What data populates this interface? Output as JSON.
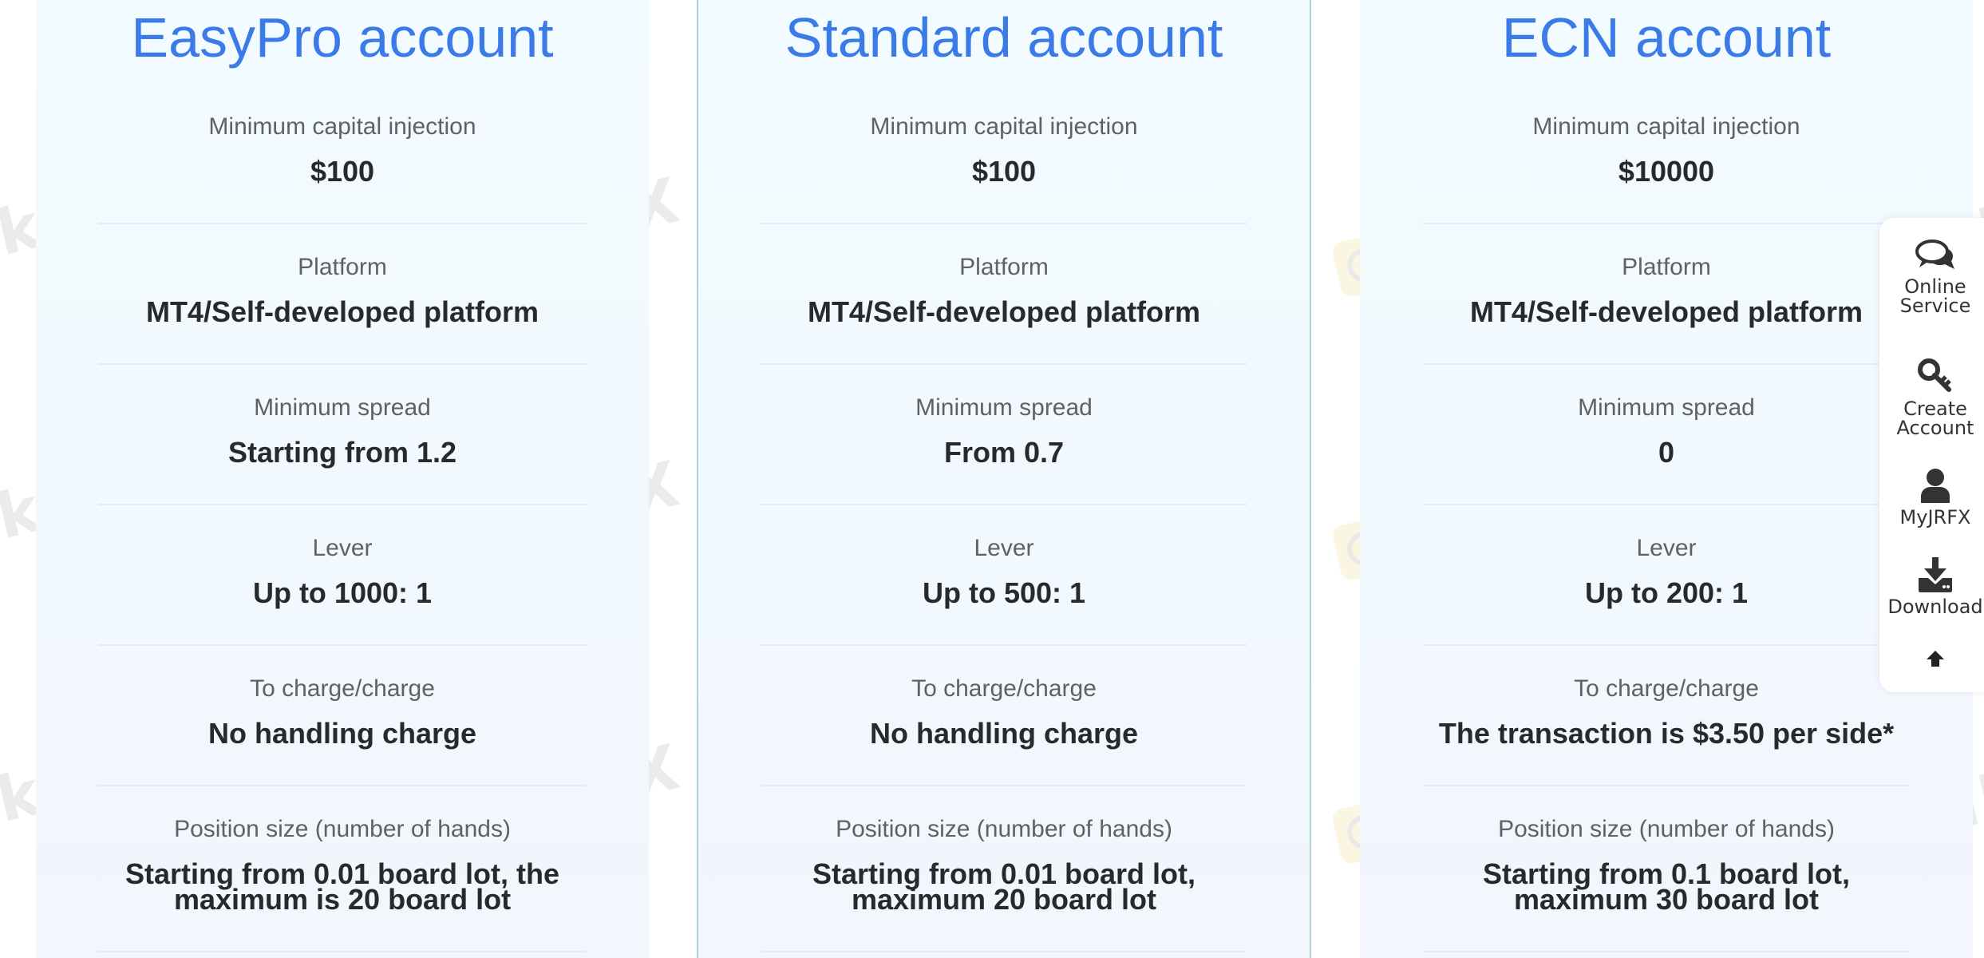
{
  "accounts": [
    {
      "title": "EasyPro account",
      "rows": [
        {
          "label": "Minimum capital injection",
          "value": "$100"
        },
        {
          "label": "Platform",
          "value": "MT4/Self-developed platform"
        },
        {
          "label": "Minimum spread",
          "value": "Starting from 1.2"
        },
        {
          "label": "Lever",
          "value": "Up to 1000: 1"
        },
        {
          "label": "To charge/charge",
          "value": "No handling charge"
        },
        {
          "label": "Position size (number of hands)",
          "value": "Starting from 0.01 board lot, the maximum is 20 board lot"
        }
      ]
    },
    {
      "title": "Standard account",
      "rows": [
        {
          "label": "Minimum capital injection",
          "value": "$100"
        },
        {
          "label": "Platform",
          "value": "MT4/Self-developed platform"
        },
        {
          "label": "Minimum spread",
          "value": "From 0.7"
        },
        {
          "label": "Lever",
          "value": "Up to 500: 1"
        },
        {
          "label": "To charge/charge",
          "value": "No handling charge"
        },
        {
          "label": "Position size (number of hands)",
          "value": "Starting from 0.01 board lot, maximum 20 board lot"
        }
      ]
    },
    {
      "title": "ECN account",
      "rows": [
        {
          "label": "Minimum capital injection",
          "value": "$10000"
        },
        {
          "label": "Platform",
          "value": "MT4/Self-developed platform"
        },
        {
          "label": "Minimum spread",
          "value": "0"
        },
        {
          "label": "Lever",
          "value": "Up to 200: 1"
        },
        {
          "label": "To charge/charge",
          "value": "The transaction is $3.50 per side*"
        },
        {
          "label": "Position size (number of hands)",
          "value": "Starting from 0.1 board lot, maximum 30 board lot"
        }
      ]
    }
  ],
  "sidebar": {
    "items": [
      {
        "label_line1": "Online",
        "label_line2": "Service",
        "icon": "chat-bubbles-icon"
      },
      {
        "label_line1": "Create",
        "label_line2": "Account",
        "icon": "key-icon"
      },
      {
        "label_line1": "MyJRFX",
        "icon": "user-icon"
      },
      {
        "label_line1": "Download",
        "icon": "download-icon"
      },
      {
        "icon": "arrow-up-icon"
      }
    ]
  },
  "watermark": {
    "text": "WikiFX"
  },
  "colors": {
    "title": "#3b7be8",
    "label": "#5d6266",
    "value": "#262a2e",
    "highlight_border": "#a9d4d8"
  }
}
